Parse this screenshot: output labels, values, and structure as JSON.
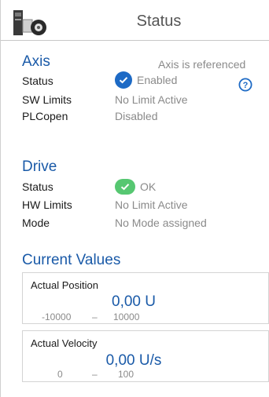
{
  "header": {
    "title": "Status",
    "device_icon": "servo-drive-icon"
  },
  "axis": {
    "title": "Axis",
    "referenced_text": "Axis is referenced",
    "rows": [
      {
        "label": "Status",
        "value": "Enabled",
        "icon": "checkmark-blue-circle-icon"
      },
      {
        "label": "SW Limits",
        "value": "No Limit Active"
      },
      {
        "label": "PLCopen",
        "value": "Disabled"
      }
    ],
    "help_icon": "help-circle-icon"
  },
  "drive": {
    "title": "Drive",
    "rows": [
      {
        "label": "Status",
        "value": "OK",
        "icon": "checkmark-green-icon"
      },
      {
        "label": "HW Limits",
        "value": "No Limit Active"
      },
      {
        "label": "Mode",
        "value": "No Mode assigned"
      }
    ]
  },
  "current_values": {
    "title": "Current Values",
    "position": {
      "label": "Actual Position",
      "value": "0,00 U",
      "min": "-10000",
      "max": "10000",
      "separator": "–"
    },
    "velocity": {
      "label": "Actual Velocity",
      "value": "0,00 U/s",
      "min": "0",
      "max": "100",
      "separator": "–"
    }
  },
  "colors": {
    "accent": "#1a5aa8",
    "status_blue": "#1d6ac5",
    "status_green": "#56c771"
  }
}
